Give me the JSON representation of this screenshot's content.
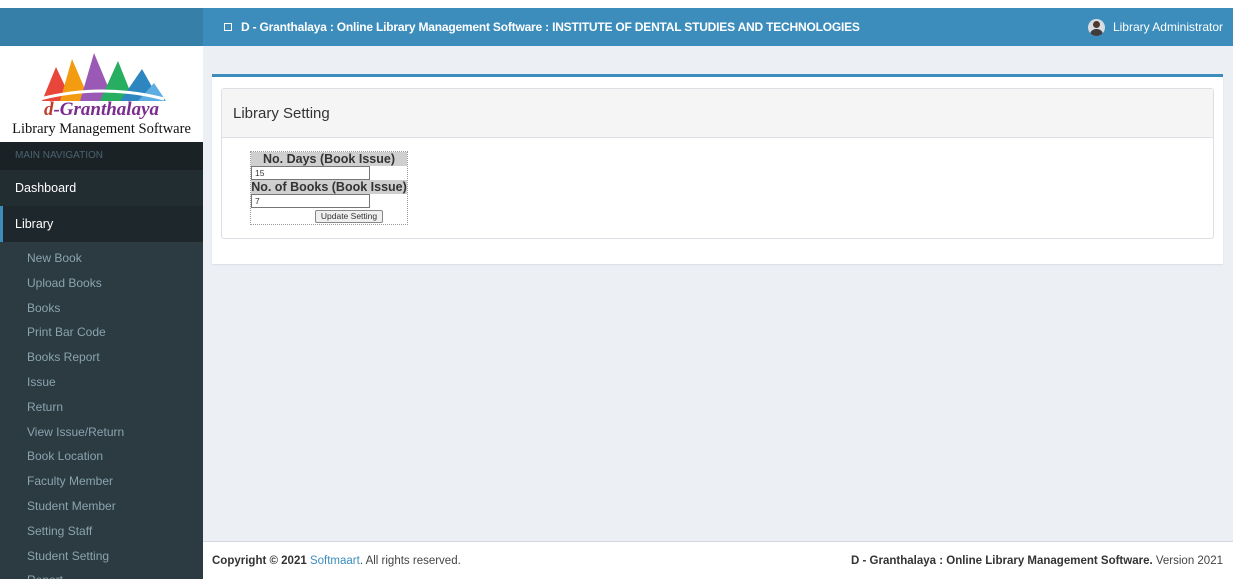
{
  "header": {
    "title": "D - Granthalaya : Online Library Management Software : INSTITUTE OF DENTAL STUDIES AND TECHNOLOGIES",
    "user_name": "Library Administrator",
    "toggle_icon": "square-toggle-icon",
    "avatar_icon": "user-avatar-icon"
  },
  "logo": {
    "name_prefix": "d",
    "name_suffix": "-Granthalaya",
    "tagline": "Library Management Software"
  },
  "sidebar": {
    "nav_header": "MAIN NAVIGATION",
    "items": [
      {
        "label": "Dashboard"
      },
      {
        "label": "Library"
      }
    ],
    "submenu": [
      {
        "label": "New Book"
      },
      {
        "label": "Upload Books"
      },
      {
        "label": "Books"
      },
      {
        "label": "Print Bar Code"
      },
      {
        "label": "Books Report"
      },
      {
        "label": "Issue"
      },
      {
        "label": "Return"
      },
      {
        "label": "View Issue/Return"
      },
      {
        "label": "Book Location"
      },
      {
        "label": "Faculty Member"
      },
      {
        "label": "Student Member"
      },
      {
        "label": "Setting Staff"
      },
      {
        "label": "Student Setting"
      },
      {
        "label": "Report"
      }
    ]
  },
  "main": {
    "panel_title": "Library Setting",
    "form": {
      "days_label": "No. Days (Book Issue)",
      "days_value": "15",
      "books_label": "No. of Books (Book Issue)",
      "books_value": "7",
      "update_button": "Update Setting"
    }
  },
  "footer": {
    "copyright_prefix": "Copyright © 2021",
    "company": "Softmaart",
    "rights": ". All rights reserved.",
    "product_name": "D - Granthalaya : Online Library Management Software.",
    "version": " Version 2021"
  },
  "colors": {
    "header": "#3c8dbc",
    "header_left": "#367fa9",
    "sidebar": "#222d32",
    "content_bg": "#ecf0f5"
  }
}
